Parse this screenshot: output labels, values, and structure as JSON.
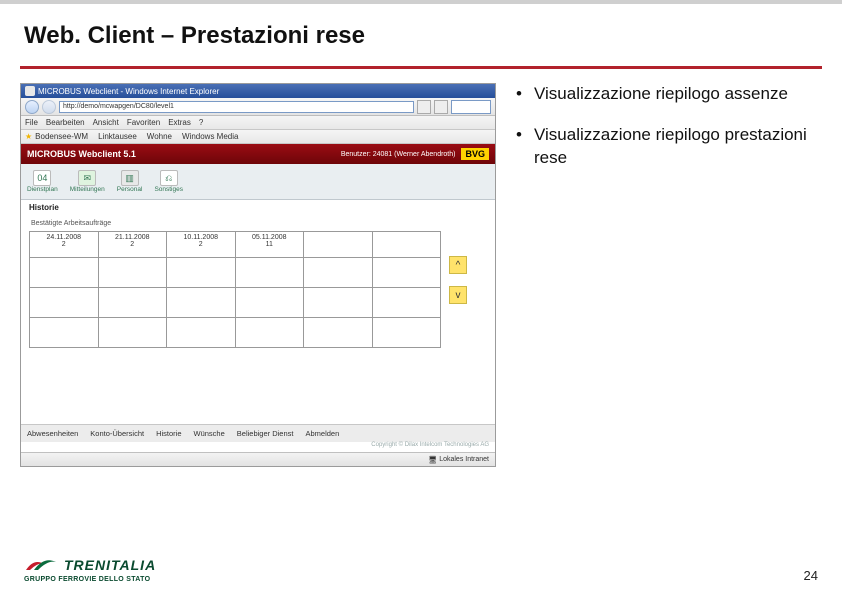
{
  "slide": {
    "title": "Web. Client – Prestazioni rese",
    "page_number": "24"
  },
  "bullets": [
    "Visualizzazione riepilogo assenze",
    "Visualizzazione riepilogo prestazioni rese"
  ],
  "logo": {
    "brand": "TRENITALIA",
    "sub": "GRUPPO FERROVIE DELLO STATO"
  },
  "screenshot": {
    "window_title": "MICROBUS Webclient - Windows Internet Explorer",
    "address": "http://demo/mcwapgen/DC80/level1",
    "ie_menu": [
      "File",
      "Bearbeiten",
      "Ansicht",
      "Favoriten",
      "Extras",
      "?"
    ],
    "fav_items": [
      "Bodensee-WM",
      "Linktausee",
      "Wohne",
      "Windows Media"
    ],
    "app_title": "MICROBUS Webclient 5.1",
    "user_label": "Benutzer: 24081 (Werner Abendroth)",
    "badge": "BVG",
    "tools": [
      {
        "icon": "04",
        "label": "Dienstplan"
      },
      {
        "icon": "✉",
        "label": "Mitteilungen"
      },
      {
        "icon": "▥",
        "label": "Personal"
      },
      {
        "icon": "⎌",
        "label": "Sonstiges"
      }
    ],
    "section": "Historie",
    "grid_sub": "Bestätigte Arbeitsaufträge",
    "columns": [
      {
        "date": "24.11.2008",
        "val": "2"
      },
      {
        "date": "21.11.2008",
        "val": "2"
      },
      {
        "date": "10.11.2008",
        "val": "2"
      },
      {
        "date": "05.11.2008",
        "val": "11"
      },
      {
        "date": "",
        "val": ""
      },
      {
        "date": "",
        "val": ""
      }
    ],
    "arrow_up": "^",
    "arrow_down": "v",
    "bottom_tabs": [
      "Abwesenheiten",
      "Konto-Übersicht",
      "Historie",
      "Wünsche",
      "Beliebiger Dienst",
      "Abmelden"
    ],
    "copyright": "Copyright © Dilax Intelcom Technologies AG",
    "status_zone": "Lokales Intranet"
  }
}
